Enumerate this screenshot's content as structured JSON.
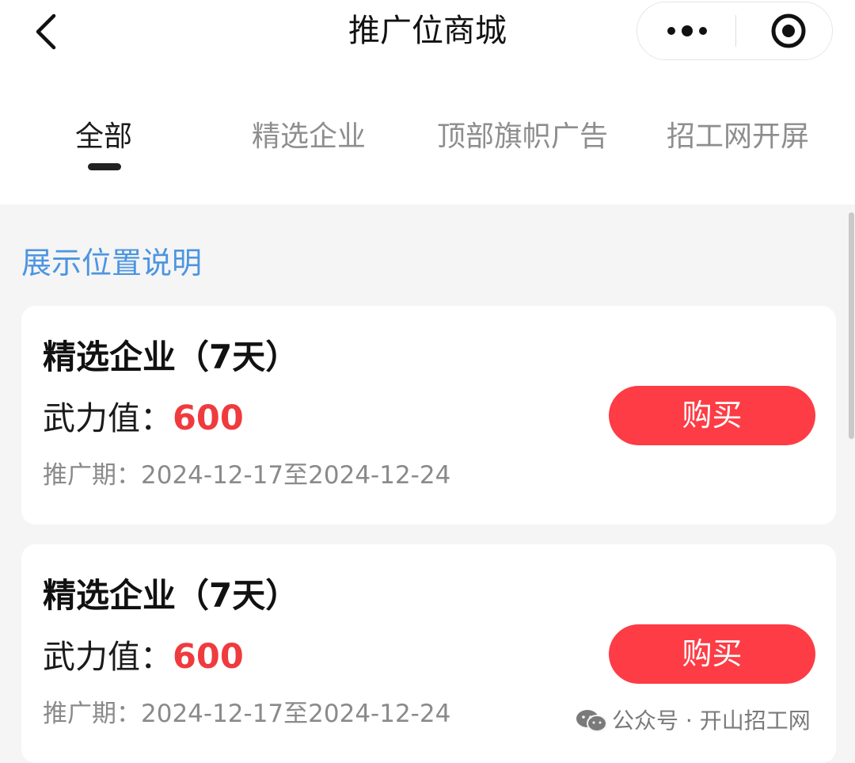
{
  "header": {
    "title": "推广位商城"
  },
  "tabs": [
    {
      "label": "全部",
      "active": true
    },
    {
      "label": "精选企业",
      "active": false
    },
    {
      "label": "顶部旗帜广告",
      "active": false
    },
    {
      "label": "招工网开屏",
      "active": false
    }
  ],
  "explain_link": "展示位置说明",
  "cards": [
    {
      "title": "精选企业（7天）",
      "power_label": "武力值：",
      "power_value": "600",
      "period": "推广期：2024-12-17至2024-12-24",
      "buy_label": "购买"
    },
    {
      "title": "精选企业（7天）",
      "power_label": "武力值：",
      "power_value": "600",
      "period": "推广期：2024-12-17至2024-12-24",
      "buy_label": "购买"
    }
  ],
  "watermark": "公众号 · 开山招工网",
  "colors": {
    "accent_red": "#fd3c45",
    "value_red": "#ef3b3e",
    "link_blue": "#4d95e0"
  },
  "icons": {
    "back": "chevron-left-icon",
    "more": "more-dots-icon",
    "close": "target-close-icon",
    "watermark": "wechat-icon"
  }
}
